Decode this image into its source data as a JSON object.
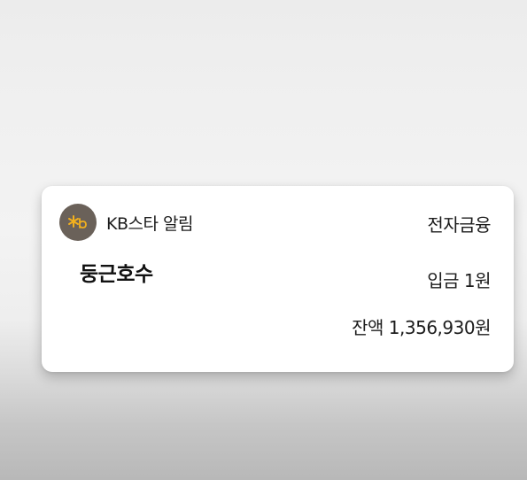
{
  "notification": {
    "app_icon": "kb-star-logo-icon",
    "app_name": "KB스타 알림",
    "category": "전자금융",
    "sender": "둥근호수",
    "amount": "입금 1원",
    "balance": "잔액 1,356,930원",
    "colors": {
      "icon_background": "#6a6159",
      "logo_star": "#f2b01e",
      "logo_text": "#f2b01e",
      "card_background": "#ffffff",
      "text": "#1c1c1c"
    }
  }
}
